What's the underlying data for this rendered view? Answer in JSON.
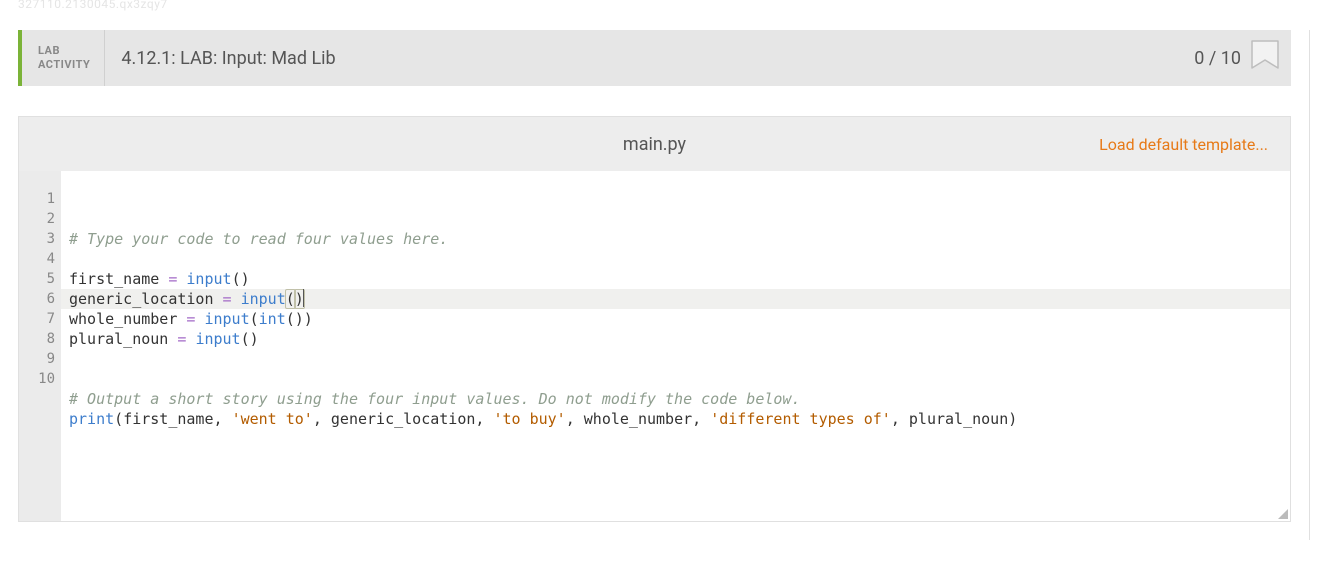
{
  "watermark": "327110.2130045.qx3zqy7",
  "header": {
    "label_line1": "LAB",
    "label_line2": "ACTIVITY",
    "title": "4.12.1: LAB: Input: Mad Lib",
    "score": "0 / 10"
  },
  "editor": {
    "filename": "main.py",
    "load_link": "Load default template...",
    "active_line": 4,
    "lines": [
      {
        "n": 1,
        "tokens": [
          {
            "t": "# Type your code to read four values here.",
            "c": "cm"
          }
        ]
      },
      {
        "n": 2,
        "tokens": []
      },
      {
        "n": 3,
        "tokens": [
          {
            "t": "first_name",
            "c": "id"
          },
          {
            "t": " ",
            "c": "pn"
          },
          {
            "t": "=",
            "c": "op"
          },
          {
            "t": " ",
            "c": "pn"
          },
          {
            "t": "input",
            "c": "fn"
          },
          {
            "t": "()",
            "c": "pn"
          }
        ]
      },
      {
        "n": 4,
        "tokens": [
          {
            "t": "generic_location",
            "c": "id"
          },
          {
            "t": " ",
            "c": "pn"
          },
          {
            "t": "=",
            "c": "op"
          },
          {
            "t": " ",
            "c": "pn"
          },
          {
            "t": "input",
            "c": "fn"
          },
          {
            "t": "(",
            "c": "pn bracket"
          },
          {
            "t": ")",
            "c": "pn bracket"
          },
          {
            "t": "",
            "c": "cursor"
          }
        ]
      },
      {
        "n": 5,
        "tokens": [
          {
            "t": "whole_number",
            "c": "id"
          },
          {
            "t": " ",
            "c": "pn"
          },
          {
            "t": "=",
            "c": "op"
          },
          {
            "t": " ",
            "c": "pn"
          },
          {
            "t": "input",
            "c": "fn"
          },
          {
            "t": "(",
            "c": "pn"
          },
          {
            "t": "int",
            "c": "fn"
          },
          {
            "t": "())",
            "c": "pn"
          }
        ]
      },
      {
        "n": 6,
        "tokens": [
          {
            "t": "plural_noun",
            "c": "id"
          },
          {
            "t": " ",
            "c": "pn"
          },
          {
            "t": "=",
            "c": "op"
          },
          {
            "t": " ",
            "c": "pn"
          },
          {
            "t": "input",
            "c": "fn"
          },
          {
            "t": "()",
            "c": "pn"
          }
        ]
      },
      {
        "n": 7,
        "tokens": []
      },
      {
        "n": 8,
        "tokens": []
      },
      {
        "n": 9,
        "tokens": [
          {
            "t": "# Output a short story using the four input values. Do not modify the code below.",
            "c": "cm"
          }
        ]
      },
      {
        "n": 10,
        "tokens": [
          {
            "t": "print",
            "c": "fn"
          },
          {
            "t": "(",
            "c": "pn"
          },
          {
            "t": "first_name",
            "c": "id"
          },
          {
            "t": ",",
            "c": "pn"
          },
          {
            "t": " ",
            "c": "pn"
          },
          {
            "t": "'went to'",
            "c": "st"
          },
          {
            "t": ",",
            "c": "pn"
          },
          {
            "t": " ",
            "c": "pn"
          },
          {
            "t": "generic_location",
            "c": "id"
          },
          {
            "t": ",",
            "c": "pn"
          },
          {
            "t": " ",
            "c": "pn"
          },
          {
            "t": "'to buy'",
            "c": "st"
          },
          {
            "t": ",",
            "c": "pn"
          },
          {
            "t": " ",
            "c": "pn"
          },
          {
            "t": "whole_number",
            "c": "id"
          },
          {
            "t": ",",
            "c": "pn"
          },
          {
            "t": " ",
            "c": "pn"
          },
          {
            "t": "'different types of'",
            "c": "st"
          },
          {
            "t": ",",
            "c": "pn"
          },
          {
            "t": " ",
            "c": "pn"
          },
          {
            "t": "plural_noun",
            "c": "id"
          },
          {
            "t": ")",
            "c": "pn"
          }
        ]
      }
    ]
  }
}
